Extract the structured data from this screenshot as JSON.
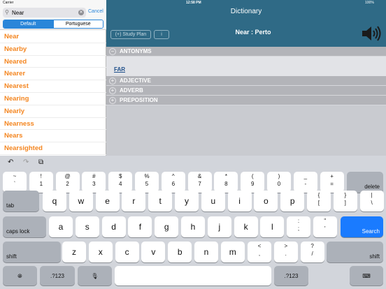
{
  "status": {
    "carrier": "Carrier",
    "time": "12:58 PM",
    "battery": "100%"
  },
  "search": {
    "value": "Near",
    "placeholder": "",
    "cancel": "Cancel"
  },
  "segments": [
    "Default",
    "Portuguese"
  ],
  "words": [
    "Near",
    "Nearby",
    "Neared",
    "Nearer",
    "Nearest",
    "Nearing",
    "Nearly",
    "Nearness",
    "Nears",
    "Nearsighted"
  ],
  "nav": {
    "title": "Dictionary"
  },
  "word_bar": {
    "study_plan": "(+) Study Plan",
    "info": "i",
    "title": "Near : Perto"
  },
  "sections": {
    "antonyms": {
      "label": "ANTONYMS",
      "sign": "−",
      "entries": [
        "FAR"
      ]
    },
    "adjective": {
      "label": "ADJECTIVE",
      "sign": "+"
    },
    "adverb": {
      "label": "ADVERB",
      "sign": "+"
    },
    "preposition": {
      "label": "PREPOSITION",
      "sign": "+"
    }
  },
  "keyboard": {
    "tools": {
      "undo": "↶",
      "redo": "↷",
      "paste": "⧉"
    },
    "row1": [
      {
        "t": "~",
        "b": "`"
      },
      {
        "t": "!",
        "b": "1"
      },
      {
        "t": "@",
        "b": "2"
      },
      {
        "t": "#",
        "b": "3"
      },
      {
        "t": "$",
        "b": "4"
      },
      {
        "t": "%",
        "b": "5"
      },
      {
        "t": "^",
        "b": "6"
      },
      {
        "t": "&",
        "b": "7"
      },
      {
        "t": "*",
        "b": "8"
      },
      {
        "t": "(",
        "b": "9"
      },
      {
        "t": ")",
        "b": "0"
      },
      {
        "t": "_",
        "b": "-"
      },
      {
        "t": "+",
        "b": "="
      }
    ],
    "delete": "delete",
    "tab": "tab",
    "row2": [
      "q",
      "w",
      "e",
      "r",
      "t",
      "y",
      "u",
      "i",
      "o",
      "p"
    ],
    "row2_sym": [
      {
        "t": "{",
        "b": "["
      },
      {
        "t": "}",
        "b": "]"
      },
      {
        "t": "|",
        "b": "\\"
      }
    ],
    "caps": "caps lock",
    "row3": [
      "a",
      "s",
      "d",
      "f",
      "g",
      "h",
      "j",
      "k",
      "l"
    ],
    "row3_sym": [
      {
        "t": ":",
        "b": ";"
      },
      {
        "t": "\"",
        "b": "'"
      }
    ],
    "search": "Search",
    "shift": "shift",
    "row4": [
      "z",
      "x",
      "c",
      "v",
      "b",
      "n",
      "m"
    ],
    "row4_sym": [
      {
        "t": "<",
        "b": ","
      },
      {
        "t": ">",
        "b": "."
      },
      {
        "t": "?",
        "b": "/"
      }
    ],
    "num": ".?123",
    "globe_icon": "globe-icon",
    "mic_icon": "microphone-icon",
    "hide_icon": "keyboard-hide-icon"
  }
}
